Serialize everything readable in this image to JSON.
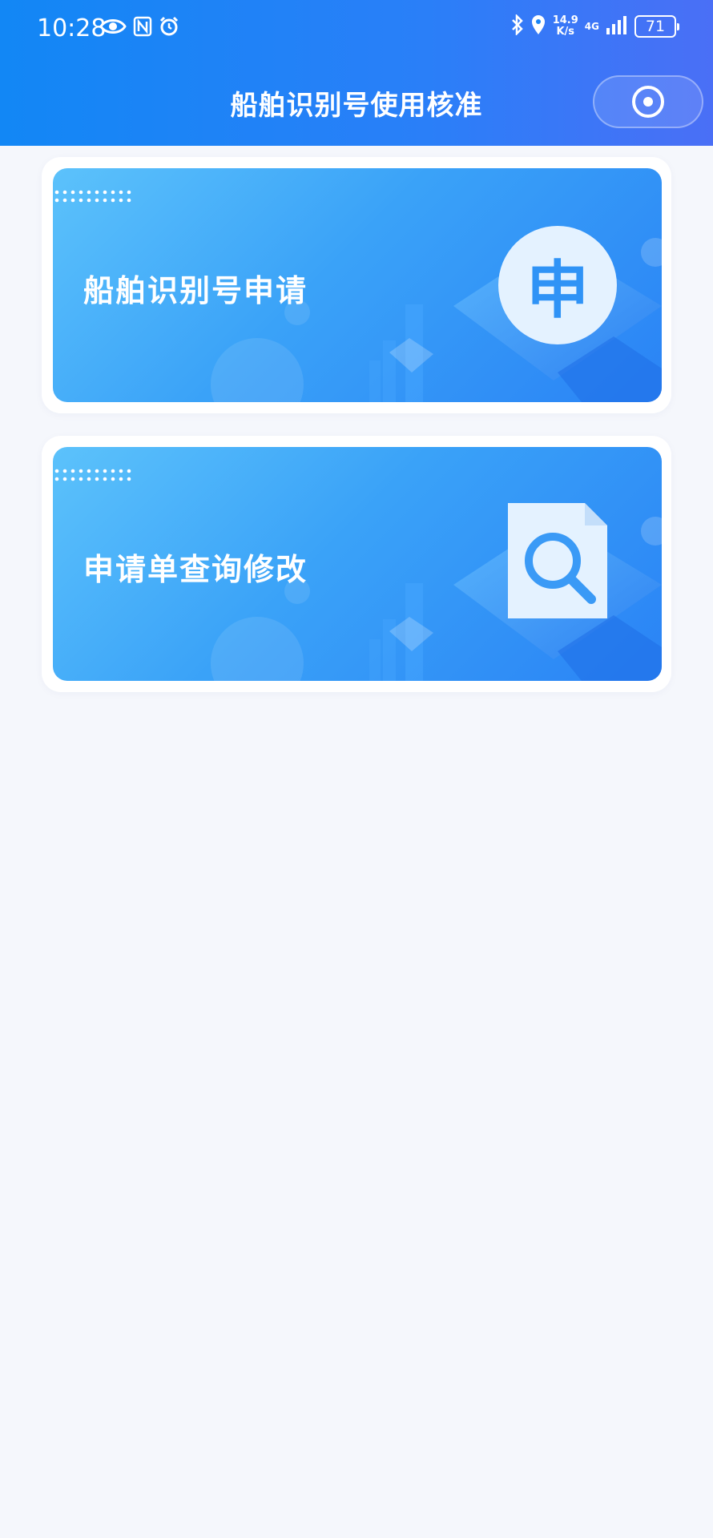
{
  "status_bar": {
    "time": "10:28",
    "net_speed_value": "14.9",
    "net_speed_unit": "K/s",
    "network": "4G",
    "battery": "71"
  },
  "nav": {
    "title": "船舶识别号使用核准"
  },
  "cards": [
    {
      "label": "船舶识别号申请",
      "badge_char": "申"
    },
    {
      "label": "申请单查询修改"
    }
  ],
  "colors": {
    "header_start": "#1287f5",
    "header_end": "#4a6ff6",
    "card_start": "#5cc2fb",
    "card_end": "#2a83f5",
    "page_bg": "#f5f7fc"
  }
}
